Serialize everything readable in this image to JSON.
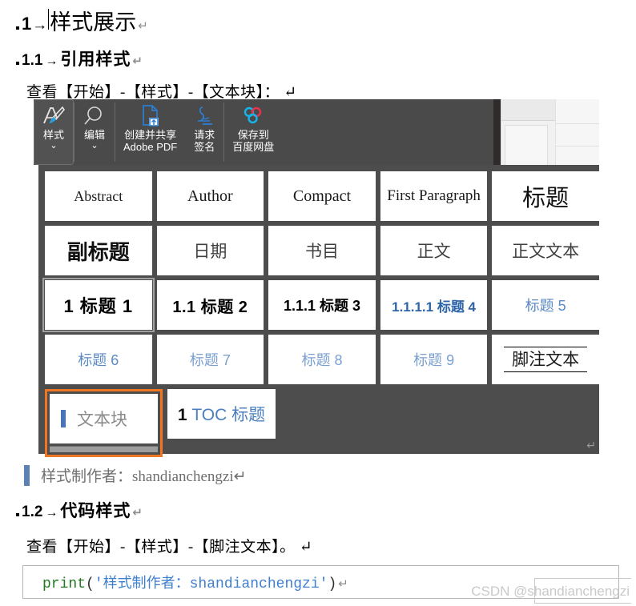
{
  "document": {
    "heading1": {
      "bullet": "▪",
      "number": "1",
      "arrow": "→",
      "text": "样式展示",
      "mark": "↵"
    },
    "heading2_a": {
      "bullet": "▪",
      "number": "1.1",
      "arrow": "→",
      "text": "引用样式",
      "mark": "↵"
    },
    "body_a": "查看【开始】-【样式】-【文本块】： ↵",
    "heading2_b": {
      "bullet": "▪",
      "number": "1.2",
      "arrow": "→",
      "text": "代码样式",
      "mark": "↵"
    },
    "body_b": "查看【开始】-【样式】-【脚注文本】。 ↵",
    "quote": "样式制作者：shandianchengzi↵"
  },
  "ribbon": {
    "buttons": [
      {
        "name": "styles",
        "icon": "style-brush-icon",
        "label": "样式",
        "chevron": "⌄",
        "selected": true
      },
      {
        "name": "editing",
        "icon": "magnifier-icon",
        "label": "编辑",
        "chevron": "⌄",
        "selected": false
      },
      {
        "name": "create-share-pdf",
        "icon": "pdf-upload-icon",
        "label_line1": "创建并共享",
        "label_line2": "Adobe PDF",
        "selected": false
      },
      {
        "name": "request-signature",
        "icon": "signature-icon",
        "label_line1": "请求",
        "label_line2": "签名",
        "selected": false
      },
      {
        "name": "save-to-baidu-netdisk",
        "icon": "baidu-cloud-icon",
        "label_line1": "保存到",
        "label_line2": "百度网盘",
        "selected": false
      }
    ]
  },
  "gallery": {
    "rows": [
      [
        {
          "name": "abstract",
          "text": "Abstract",
          "style": "st-abstract",
          "state": "normal"
        },
        {
          "name": "author",
          "text": "Author",
          "style": "st-author",
          "state": "normal"
        },
        {
          "name": "compact",
          "text": "Compact",
          "style": "st-compact",
          "state": "normal"
        },
        {
          "name": "first-paragraph",
          "text": "First Paragraph",
          "style": "st-firstpara",
          "state": "normal"
        },
        {
          "name": "title",
          "text": "标题",
          "style": "st-biaoti",
          "state": "normal"
        }
      ],
      [
        {
          "name": "subtitle",
          "text": "副标题",
          "style": "st-fubiaoti",
          "state": "normal"
        },
        {
          "name": "date",
          "text": "日期",
          "style": "st-riqi",
          "state": "normal"
        },
        {
          "name": "bibliography",
          "text": "书目",
          "style": "st-shumu",
          "state": "normal"
        },
        {
          "name": "body",
          "text": "正文",
          "style": "st-zhengwen",
          "state": "normal"
        },
        {
          "name": "body-text",
          "text": "正文文本",
          "style": "st-zwtext",
          "state": "normal"
        }
      ],
      [
        {
          "name": "heading-1",
          "text": "1  标题 1",
          "style": "st-h1",
          "state": "highlighted"
        },
        {
          "name": "heading-2",
          "text": "1.1  标题 2",
          "style": "st-h2",
          "state": "normal"
        },
        {
          "name": "heading-3",
          "text": "1.1.1  标题 3",
          "style": "st-h3",
          "state": "normal"
        },
        {
          "name": "heading-4",
          "text": "1.1.1.1  标题 4",
          "style": "st-h4",
          "state": "normal"
        },
        {
          "name": "heading-5",
          "text": "标题 5",
          "style": "st-h5",
          "state": "normal"
        }
      ],
      [
        {
          "name": "heading-6",
          "text": "标题 6",
          "style": "st-h6",
          "state": "normal"
        },
        {
          "name": "heading-7",
          "text": "标题 7",
          "style": "st-h7",
          "state": "normal"
        },
        {
          "name": "heading-8",
          "text": "标题 8",
          "style": "st-h8",
          "state": "normal"
        },
        {
          "name": "heading-9",
          "text": "标题 9",
          "style": "st-h9",
          "state": "normal"
        },
        {
          "name": "footnote-text",
          "text": "脚注文本",
          "style": "st-footnote",
          "state": "normal"
        }
      ]
    ],
    "last_row": {
      "selected_tile": {
        "name": "text-block",
        "text": "文本块",
        "style": "st-textblock",
        "state": "selected",
        "accent": "#ef7622"
      },
      "toc_tile": {
        "name": "toc-heading-1",
        "num": "1",
        "text": "TOC 标题",
        "style": "st-toc",
        "state": "normal"
      }
    },
    "pilcrow": "↵"
  },
  "code_block": {
    "fn": "print",
    "open_paren": "(",
    "string": "'样式制作者：shandianchengzi'",
    "close_paren": ")",
    "mark": "↵"
  },
  "watermark": {
    "text": "CSDN @shandianchengzi"
  },
  "colors": {
    "ribbon_bg": "#4a4a4a",
    "gallery_bg": "#4d4d4d",
    "selection_orange": "#ef7622",
    "quote_blue": "#5c82b3",
    "heading_blue": "#4b7fc0"
  }
}
